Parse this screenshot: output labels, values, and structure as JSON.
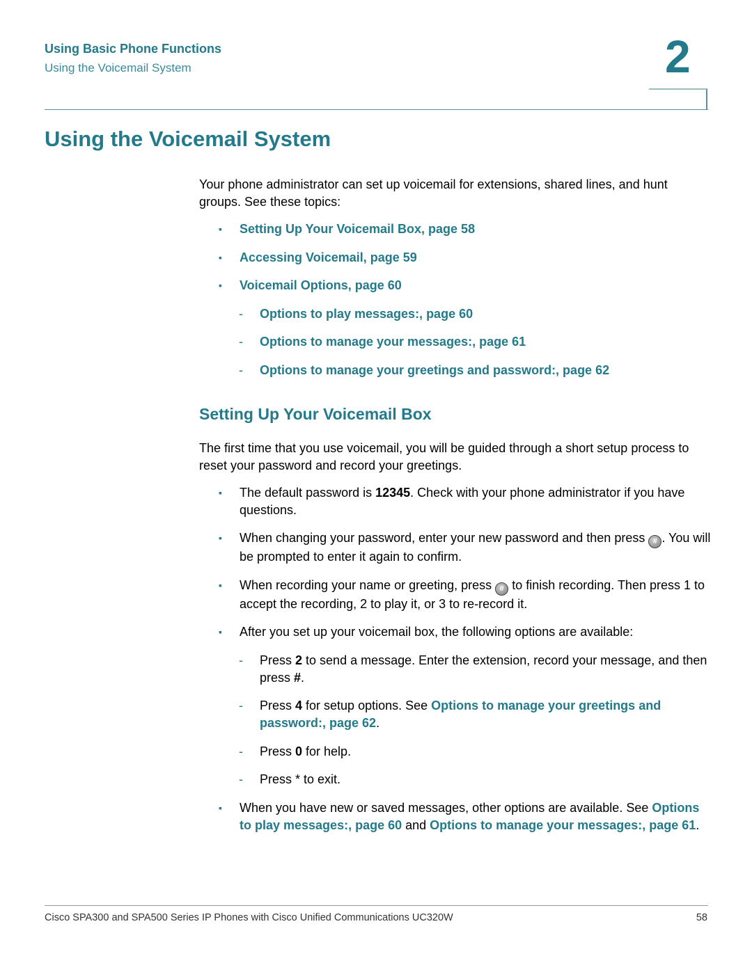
{
  "header": {
    "chapter_title": "Using Basic Phone Functions",
    "section_title": "Using the Voicemail System",
    "chapter_number": "2"
  },
  "page_title": "Using the Voicemail System",
  "intro": "Your phone administrator can set up voicemail for extensions, shared lines, and hunt groups. See these topics:",
  "toc": [
    {
      "level": 1,
      "label": "Setting Up Your Voicemail Box, page 58"
    },
    {
      "level": 1,
      "label": "Accessing Voicemail, page 59"
    },
    {
      "level": 1,
      "label": "Voicemail Options, page 60"
    },
    {
      "level": 2,
      "label": "Options to play messages:, page 60"
    },
    {
      "level": 2,
      "label": "Options to manage your messages:, page 61"
    },
    {
      "level": 2,
      "label": "Options to manage your greetings and password:, page 62"
    }
  ],
  "section": {
    "title": "Setting Up Your Voicemail Box",
    "intro": "The first time that you use voicemail, you will be guided through a short setup process to reset your password and record your greetings.",
    "bullets": {
      "b1_pre": "The default password is ",
      "b1_bold": "12345",
      "b1_post": ". Check with your phone administrator if you have questions.",
      "b2_pre": "When changing your password, enter your new password and then press ",
      "b2_post": ". You will be prompted to enter it again to confirm.",
      "b3_pre": "When recording your name or greeting, press ",
      "b3_post": " to finish recording. Then press 1 to accept the recording, 2 to play it, or 3 to re-record it.",
      "b4": "After you set up your voicemail box, the following options are available:",
      "d1_pre": "Press ",
      "d1_bold": "2",
      "d1_mid": " to send a message. Enter the extension, record your message, and then press ",
      "d1_bold2": "#",
      "d1_post": ".",
      "d2_pre": "Press ",
      "d2_bold": "4",
      "d2_mid": " for setup options. See ",
      "d2_link": "Options to manage your greetings and password:, page 62",
      "d2_post": ".",
      "d3_pre": "Press ",
      "d3_bold": "0",
      "d3_post": " for help.",
      "d4": "Press * to exit.",
      "b5_pre": "When you have new or saved messages, other options are available. See ",
      "b5_link1": "Options to play messages:, page 60",
      "b5_mid": " and ",
      "b5_link2": "Options to manage your messages:, page 61",
      "b5_post": "."
    },
    "key_icon_label": "#"
  },
  "footer": {
    "text": "Cisco SPA300 and SPA500 Series IP Phones with Cisco Unified Communications UC320W",
    "page": "58"
  }
}
